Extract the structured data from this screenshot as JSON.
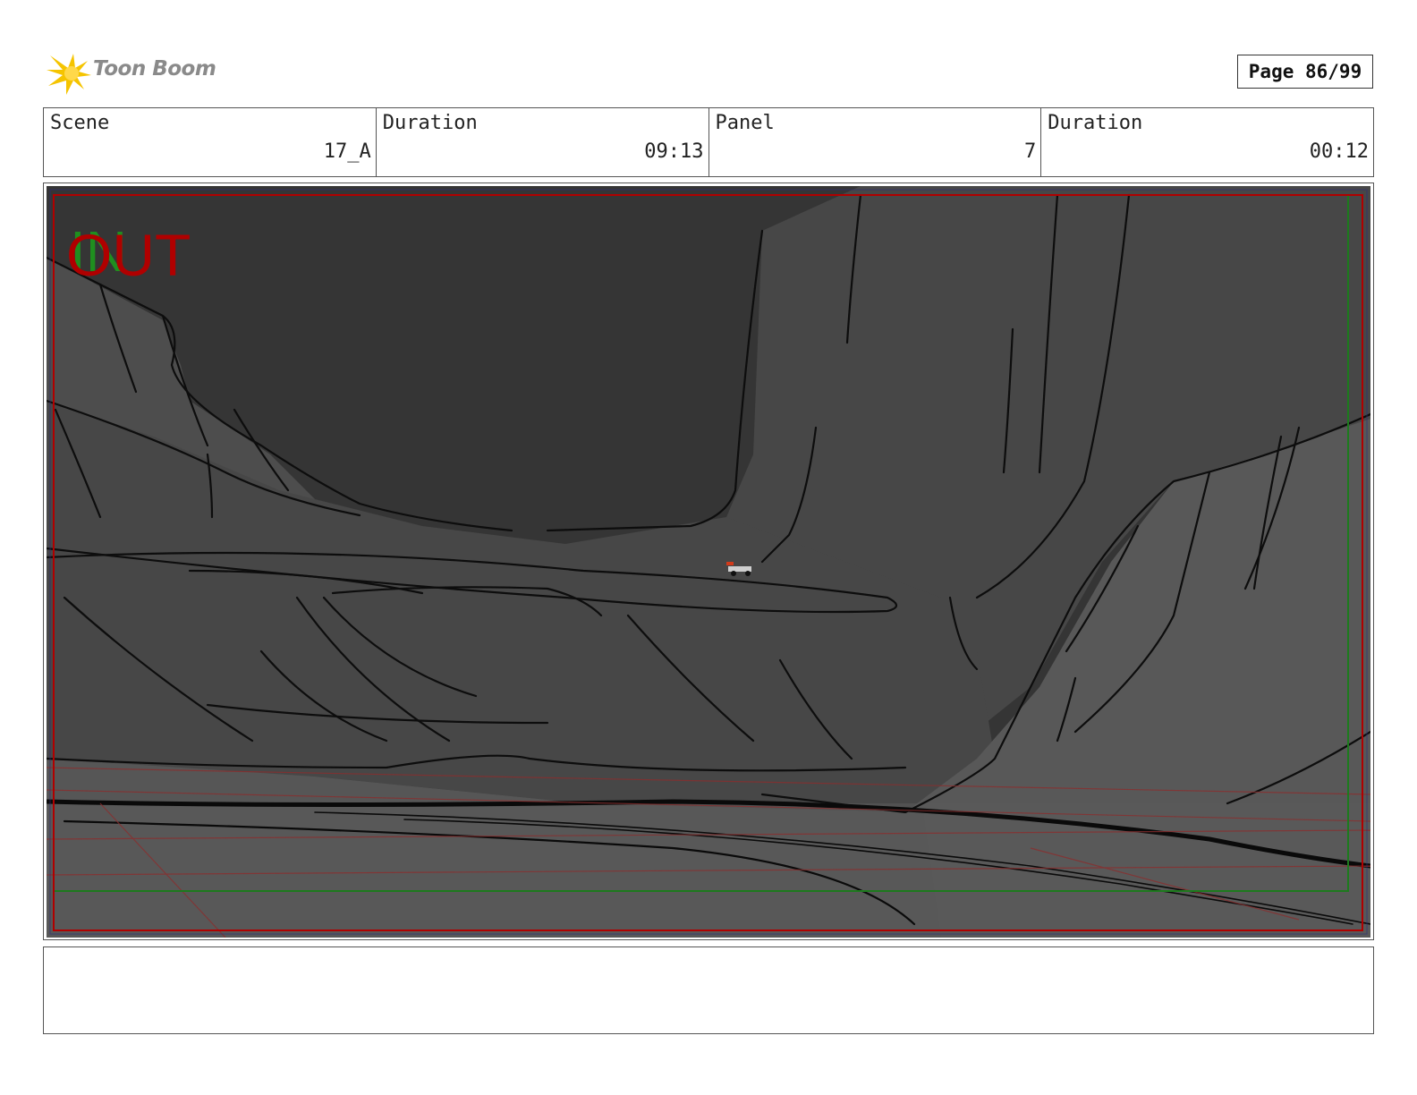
{
  "header": {
    "brand": "Toon Boom",
    "page_label": "Page 86/99"
  },
  "info": {
    "scene_label": "Scene",
    "scene_value": "17_A",
    "scene_duration_label": "Duration",
    "scene_duration_value": "09:13",
    "panel_label": "Panel",
    "panel_value": "7",
    "panel_duration_label": "Duration",
    "panel_duration_value": "00:12"
  },
  "panel": {
    "in_marker": "IN",
    "out_marker": "OUT"
  },
  "notes": {
    "text": ""
  },
  "colors": {
    "logo_yellow": "#f5c400",
    "in_marker": "#1f8f1f",
    "out_marker": "#b00000",
    "sky": "#353535",
    "cliff_dark": "#474747",
    "cliff_light": "#585858"
  }
}
